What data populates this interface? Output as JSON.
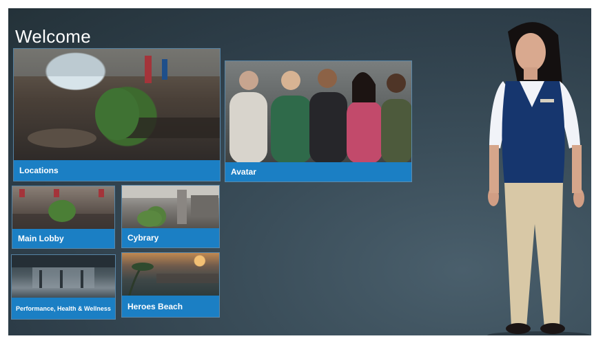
{
  "header": {
    "title": "Welcome"
  },
  "tiles": [
    {
      "label": "Locations"
    },
    {
      "label": "Avatar"
    },
    {
      "label": "Main Lobby"
    },
    {
      "label": "Cybrary"
    },
    {
      "label": "Performance, Health & Wellness"
    },
    {
      "label": "Heroes Beach"
    }
  ],
  "colors": {
    "accent": "#1b7fc4",
    "background": "#2f3f4a"
  }
}
